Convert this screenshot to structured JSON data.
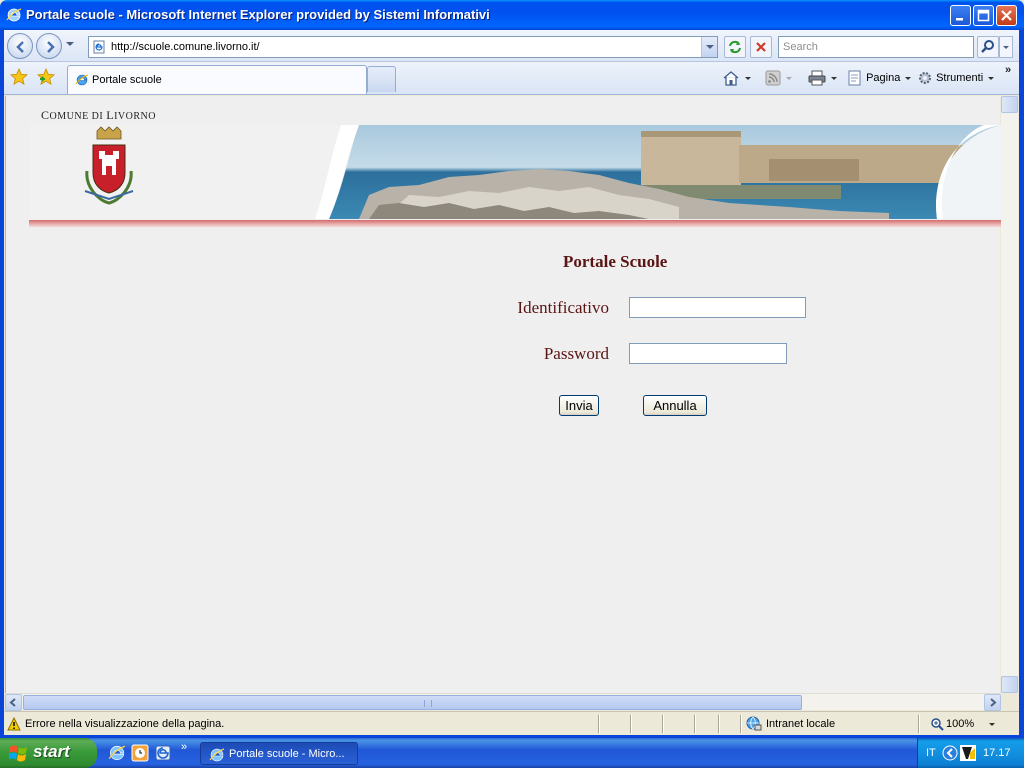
{
  "window": {
    "title": "Portale scuole - Microsoft Internet Explorer provided by Sistemi Informativi"
  },
  "address_bar": {
    "url": "http://scuole.comune.livorno.it/"
  },
  "search": {
    "placeholder": "Search"
  },
  "tabs": [
    {
      "label": "Portale scuole"
    }
  ],
  "command_bar": {
    "page_label": "Pagina",
    "tools_label": "Strumenti"
  },
  "page": {
    "logo_text_first": "C",
    "logo_text_rest": "OMUNE DI ",
    "logo_text_l": "L",
    "logo_text_rest2": "IVORNO",
    "title": "Portale Scuole",
    "username_label": "Identificativo",
    "password_label": "Password",
    "submit_label": "Invia",
    "cancel_label": "Annulla"
  },
  "status_bar": {
    "message": "Errore nella visualizzazione della pagina.",
    "zone": "Intranet locale",
    "zoom": "100%"
  },
  "taskbar": {
    "start_label": "start",
    "task_label": "Portale scuole - Micro...",
    "language": "IT",
    "time": "17.17"
  },
  "colors": {
    "titlebar": "#0053ee",
    "form_text": "#5a1414",
    "banner_line": "#d26b6b",
    "start_green": "#3a9b3a"
  }
}
